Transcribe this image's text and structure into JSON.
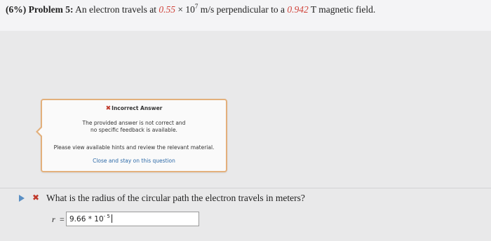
{
  "problem": {
    "label": "(6%) Problem 5:",
    "text_before": "An electron travels at ",
    "speed": "0.55",
    "times": " × 10",
    "exp": "7",
    "text_mid": " m/s perpendicular to a ",
    "field": "0.942",
    "text_after": " T magnetic field."
  },
  "feedback": {
    "title": "Incorrect Answer",
    "line1": "The provided answer is not correct and",
    "line2": "no specific feedback is available.",
    "hint": "Please view available hints and review the relevant material.",
    "close": "Close and stay on this question"
  },
  "question": {
    "text": "What is the radius of the circular path the electron travels in meters?",
    "var": "r",
    "eq": "=",
    "answer_mantissa": "9.66 * 10",
    "answer_exp": "- 5"
  },
  "colors": {
    "accent": "#d0433a",
    "popup_border": "#e3b07c",
    "link": "#2d6aa8"
  }
}
